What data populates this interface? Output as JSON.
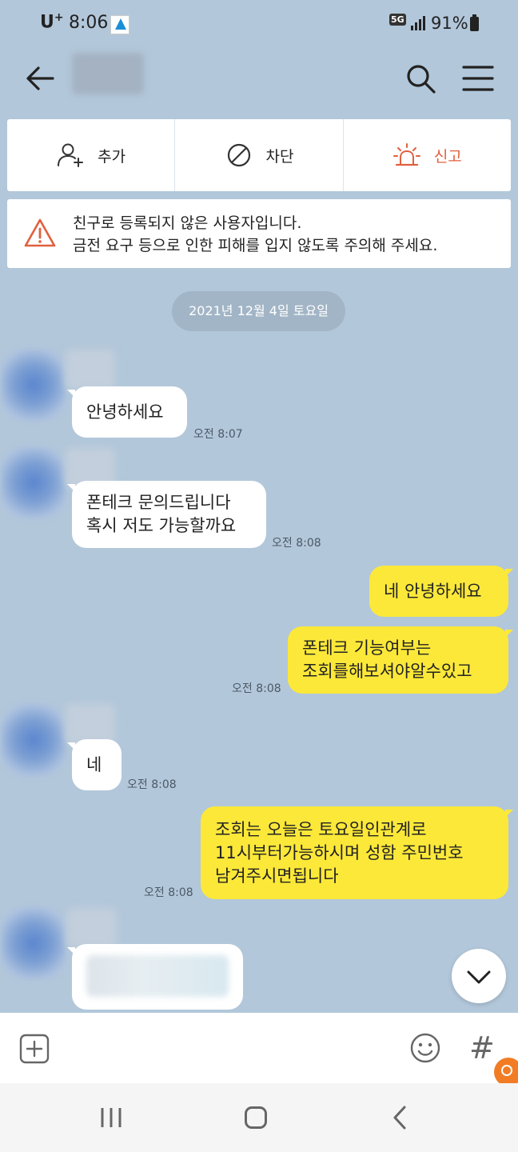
{
  "status_bar": {
    "carrier": "U",
    "carrier_sup": "+",
    "time": "8:06",
    "network": "5G",
    "battery": "91%"
  },
  "header": {
    "back_icon": "arrow-left-icon",
    "search_icon": "search-icon",
    "menu_icon": "hamburger-menu-icon"
  },
  "actions": [
    {
      "label": "추가",
      "icon": "add-friend-icon"
    },
    {
      "label": "차단",
      "icon": "block-icon"
    },
    {
      "label": "신고",
      "icon": "siren-icon",
      "color": "#e0603f"
    }
  ],
  "warning": {
    "line1": "친구로 등록되지 않은 사용자입니다.",
    "line2": "금전 요구 등으로 인한 피해를 입지 않도록 주의해 주세요."
  },
  "date": "2021년 12월 4일 토요일",
  "messages": [
    {
      "dir": "in",
      "lines": [
        "안녕하세요"
      ],
      "time": "오전 8:07"
    },
    {
      "dir": "in",
      "lines": [
        "폰테크 문의드립니다",
        "혹시 저도 가능할까요"
      ],
      "time": "오전 8:08"
    },
    {
      "dir": "out",
      "lines": [
        "네 안녕하세요"
      ],
      "time": ""
    },
    {
      "dir": "out",
      "lines": [
        "폰테크 기능여부는",
        "조회를해보셔야알수있고"
      ],
      "time": "오전 8:08"
    },
    {
      "dir": "in",
      "lines": [
        "네"
      ],
      "time": "오전 8:08"
    },
    {
      "dir": "out",
      "lines": [
        "조회는 오늘은 토요일인관계로",
        "11시부터가능하시며 성함 주민번호",
        "남겨주시면됩니다"
      ],
      "time": "오전 8:08"
    }
  ],
  "colors": {
    "background": "#b2c7da",
    "outgoing_bubble": "#fce839",
    "incoming_bubble": "#ffffff",
    "report_accent": "#e0603f"
  },
  "input_bar": {
    "plus_icon": "plus-square-icon",
    "emoji_icon": "emoji-icon",
    "hash_label": "#"
  }
}
